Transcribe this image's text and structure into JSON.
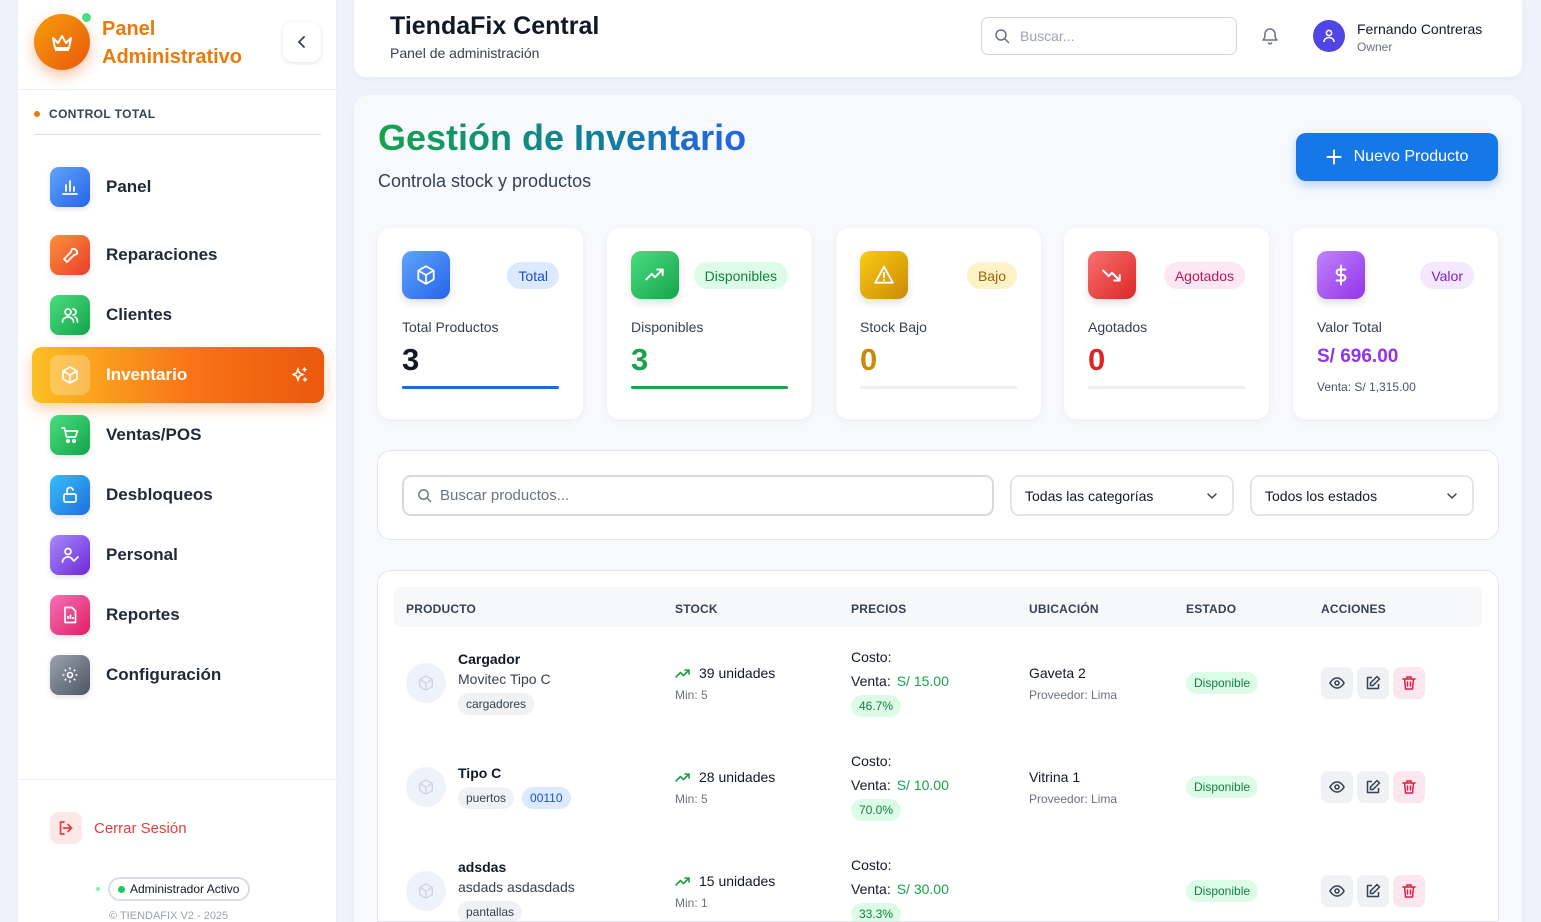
{
  "sidebar": {
    "brand_title": "Panel Administrativo",
    "section_label": "CONTROL TOTAL",
    "items": [
      {
        "label": "Panel",
        "icon": "chart-icon",
        "color": "#3b82f6"
      },
      {
        "label": "Reparaciones",
        "icon": "wrench-icon",
        "color": "#f0642c"
      },
      {
        "label": "Clientes",
        "icon": "users-icon",
        "color": "#22c55e"
      },
      {
        "label": "Inventario",
        "icon": "box-icon",
        "active": true
      },
      {
        "label": "Ventas/POS",
        "icon": "cart-icon",
        "color": "#22c55e"
      },
      {
        "label": "Desbloqueos",
        "icon": "unlock-icon",
        "color": "#1e9ce8"
      },
      {
        "label": "Personal",
        "icon": "user-check-icon",
        "color": "#8b5cf6"
      },
      {
        "label": "Reportes",
        "icon": "file-icon",
        "color": "#ec4899"
      },
      {
        "label": "Configuración",
        "icon": "gear-icon",
        "color": "#6b7280"
      }
    ],
    "logout_label": "Cerrar Sesión",
    "status_label": "Administrador Activo",
    "copyright": "© TIENDAFIX V2 - 2025"
  },
  "header": {
    "title": "TiendaFix Central",
    "subtitle": "Panel de administración",
    "search_placeholder": "Buscar...",
    "user_name": "Fernando Contreras",
    "user_role": "Owner"
  },
  "page": {
    "title": "Gestión de Inventario",
    "subtitle": "Controla stock y productos",
    "new_button": "Nuevo Producto"
  },
  "stats": [
    {
      "badge": "Total",
      "label": "Total Productos",
      "value": "3",
      "bar_fill": 1.0,
      "color": "#2563eb"
    },
    {
      "badge": "Disponibles",
      "label": "Disponibles",
      "value": "3",
      "bar_fill": 1.0,
      "color": "#16a34a"
    },
    {
      "badge": "Bajo",
      "label": "Stock Bajo",
      "value": "0",
      "bar_fill": 0,
      "color": "#ca8a04"
    },
    {
      "badge": "Agotados",
      "label": "Agotados",
      "value": "0",
      "bar_fill": 0,
      "color": "#dc2626"
    },
    {
      "badge": "Valor",
      "label": "Valor Total",
      "value": "S/ 696.00",
      "sale": "Venta: S/ 1,315.00",
      "color": "#9333ea"
    }
  ],
  "filters": {
    "search_placeholder": "Buscar productos...",
    "category": "Todas las categorías",
    "status": "Todos los estados"
  },
  "table": {
    "headers": [
      "PRODUCTO",
      "STOCK",
      "PRECIOS",
      "UBICACIÓN",
      "ESTADO",
      "ACCIONES"
    ],
    "cost_label": "Costo:",
    "sale_label": "Venta:",
    "rows": [
      {
        "name": "Cargador",
        "desc": "Movitec Tipo C",
        "tags": [
          "cargadores"
        ],
        "stock": "39 unidades",
        "min": "Min: 5",
        "price": "S/ 15.00",
        "margin": "46.7%",
        "location": "Gaveta 2",
        "provider": "Proveedor: Lima",
        "status": "Disponible"
      },
      {
        "name": "Tipo C",
        "desc": "",
        "tags": [
          "puertos",
          "00110"
        ],
        "stock": "28 unidades",
        "min": "Min: 5",
        "price": "S/ 10.00",
        "margin": "70.0%",
        "location": "Vitrina 1",
        "provider": "Proveedor: Lima",
        "status": "Disponible"
      },
      {
        "name": "adsdas",
        "desc": "asdads asdasdads",
        "tags": [
          "pantallas"
        ],
        "stock": "15 unidades",
        "min": "Min: 1",
        "price": "S/ 30.00",
        "margin": "33.3%",
        "location": "",
        "provider": "",
        "status": "Disponible"
      }
    ]
  }
}
